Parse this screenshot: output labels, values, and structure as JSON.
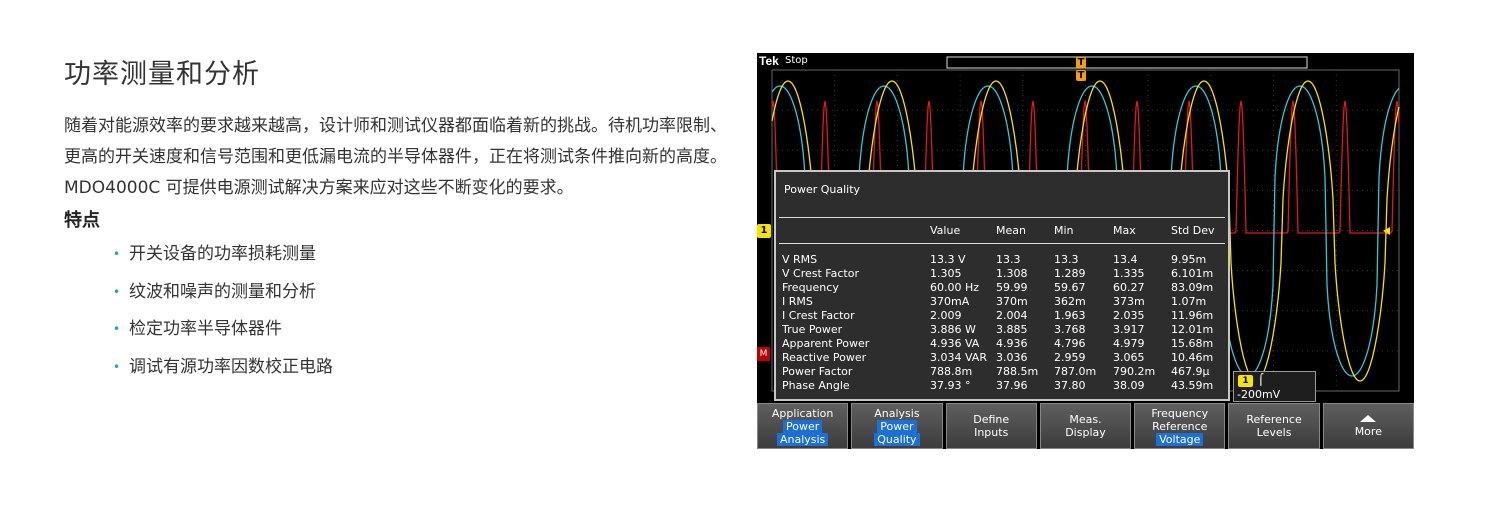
{
  "page_title": "功率测量和分析",
  "intro": "随着对能源效率的要求越来越高，设计师和测试仪器都面临着新的挑战。待机功率限制、更高的开关速度和信号范围和更低漏电流的半导体器件，正在将测试条件推向新的高度。MDO4000C 可提供电源测试解决方案来应对这些不断变化的要求。",
  "features_heading": "特点",
  "features": [
    "开关设备的功率损耗测量",
    "纹波和噪声的测量和分析",
    "检定功率半导体器件",
    "调试有源功率因数校正电路"
  ],
  "scope": {
    "logo": "Tek",
    "status": "Stop",
    "trigger_marker": "T",
    "channel_marker": "1",
    "math_marker": "M",
    "panel": {
      "title": "Power Quality",
      "columns": [
        "",
        "Value",
        "Mean",
        "Min",
        "Max",
        "Std Dev"
      ],
      "rows": [
        [
          "V RMS",
          "13.3 V",
          "13.3",
          "13.3",
          "13.4",
          "9.95m"
        ],
        [
          "V Crest Factor",
          "1.305",
          "1.308",
          "1.289",
          "1.335",
          "6.101m"
        ],
        [
          "Frequency",
          "60.00 Hz",
          "59.99",
          "59.67",
          "60.27",
          "83.09m"
        ],
        [
          "I RMS",
          "370mA",
          "370m",
          "362m",
          "373m",
          "1.07m"
        ],
        [
          "I Crest Factor",
          "2.009",
          "2.004",
          "1.963",
          "2.035",
          "11.96m"
        ],
        [
          "True Power",
          "3.886 W",
          "3.885",
          "3.768",
          "3.917",
          "12.01m"
        ],
        [
          "Apparent Power",
          "4.936 VA",
          "4.936",
          "4.796",
          "4.979",
          "15.68m"
        ],
        [
          "Reactive Power",
          "3.034 VAR",
          "3.036",
          "2.959",
          "3.065",
          "10.46m"
        ],
        [
          "Power Factor",
          "788.8m",
          "788.5m",
          "787.0m",
          "790.2m",
          "467.9µ"
        ],
        [
          "Phase Angle",
          "37.93 °",
          "37.96",
          "37.80",
          "38.09",
          "43.59m"
        ]
      ]
    },
    "trigger_readout": {
      "channel": "1",
      "slope": "⌠",
      "level": "-200mV"
    },
    "softkeys": [
      {
        "top": "Application",
        "hl1": "Power",
        "hl2": "Analysis"
      },
      {
        "top": "Analysis",
        "hl1": "Power",
        "hl2": "Quality"
      },
      {
        "line1": "Define",
        "line2": "Inputs"
      },
      {
        "line1": "Meas.",
        "line2": "Display"
      },
      {
        "line1": "Frequency",
        "line2": "Reference",
        "hl1": "Voltage"
      },
      {
        "line1": "Reference",
        "line2": "Levels"
      },
      {
        "line1": "More"
      }
    ],
    "colors": {
      "ch1": "#f5e400",
      "ch2": "#33c7d6",
      "ch3": "#e01a1a",
      "grid": "#3c3c3c",
      "highlight": "#1b6fd6"
    }
  }
}
